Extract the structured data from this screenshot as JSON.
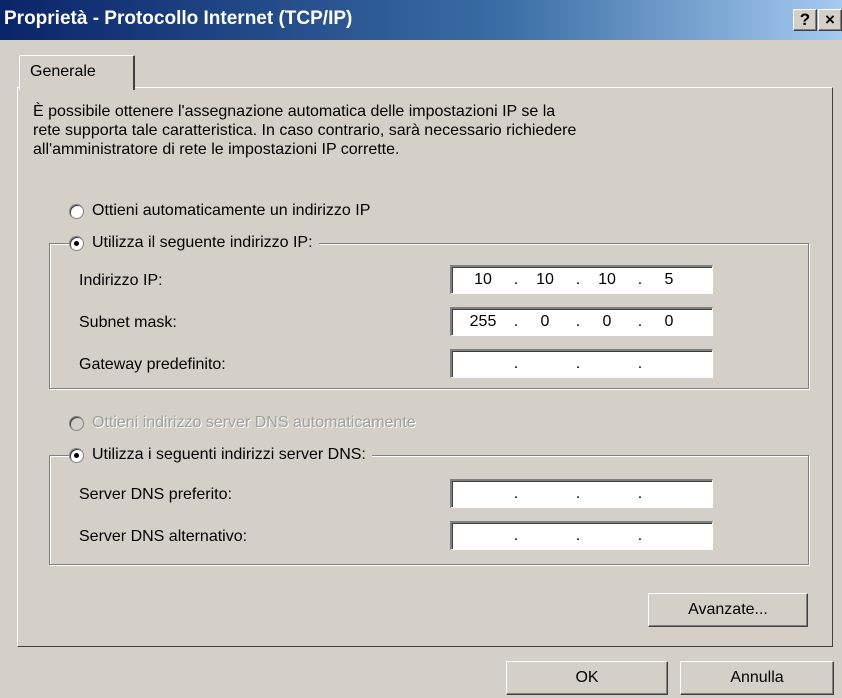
{
  "window": {
    "title": "Proprietà - Protocollo Internet (TCP/IP)",
    "help_label": "?",
    "close_label": "×"
  },
  "tabs": [
    {
      "label": "Generale",
      "selected": true
    }
  ],
  "description": [
    "È possibile ottenere l'assegnazione automatica delle impostazioni IP se la",
    "rete supporta tale caratteristica. In caso contrario, sarà necessario richiedere",
    "all'amministratore di rete le impostazioni IP corrette."
  ],
  "ip_options": {
    "auto_label": "Ottieni automaticamente un indirizzo IP",
    "auto_checked": false,
    "manual_label": "Utilizza il seguente indirizzo IP:",
    "manual_checked": true
  },
  "ip_fields": [
    {
      "label": "Indirizzo IP:",
      "octets": [
        "10",
        "10",
        "10",
        "5"
      ]
    },
    {
      "label": "Subnet mask:",
      "octets": [
        "255",
        "0",
        "0",
        "0"
      ]
    },
    {
      "label": "Gateway predefinito:",
      "octets": [
        "",
        "",
        "",
        ""
      ]
    }
  ],
  "dns_options": {
    "auto_label": "Ottieni indirizzo server DNS automaticamente",
    "auto_checked": false,
    "auto_disabled": true,
    "manual_label": "Utilizza i seguenti indirizzi server DNS:",
    "manual_checked": true
  },
  "dns_fields": [
    {
      "label": "Server DNS preferito:",
      "octets": [
        "",
        "",
        "",
        ""
      ]
    },
    {
      "label": "Server DNS alternativo:",
      "octets": [
        "",
        "",
        "",
        ""
      ]
    }
  ],
  "buttons": {
    "advanced": "Avanzate...",
    "ok": "OK",
    "cancel": "Annulla"
  },
  "ip_separator": ".",
  "colors": {
    "dialog_face": "#d4d0c8",
    "titlebar_start": "#0a246a",
    "titlebar_end": "#a6caf0",
    "disabled_text": "#a0a0a0"
  }
}
